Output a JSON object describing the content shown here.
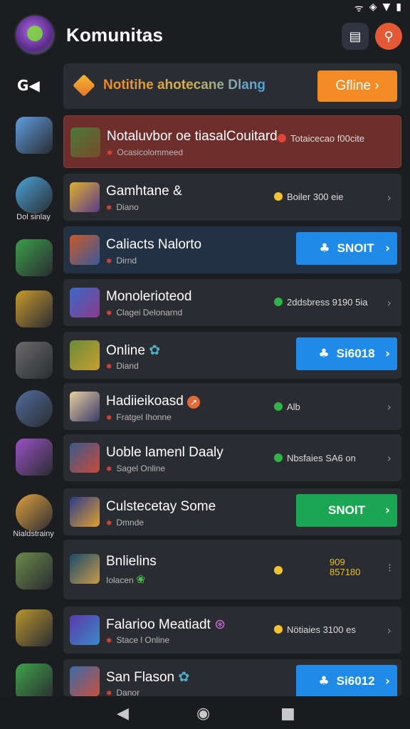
{
  "status_icons": [
    "signal-icon",
    "vibrate-icon",
    "wifi-icon",
    "battery-icon"
  ],
  "header": {
    "title": "Komunitas"
  },
  "sidebar": {
    "back_label": "G◀",
    "items": [
      {
        "label": "",
        "color": "#5e9de0"
      },
      {
        "label": "Dol sinlay",
        "color": "#4aa3d8"
      },
      {
        "label": "",
        "color": "#3d9e4a"
      },
      {
        "label": "",
        "color": "#c99a2e"
      },
      {
        "label": "",
        "color": "#6b6b6b"
      },
      {
        "label": "",
        "color": "#506c9c"
      },
      {
        "label": "",
        "color": "#9a52c4"
      },
      {
        "label": "Nialdstrainy",
        "color": "#e0a040"
      },
      {
        "label": "",
        "color": "#6a8a4a"
      },
      {
        "label": "",
        "color": "#b8952e"
      },
      {
        "label": "",
        "color": "#3ea34a"
      }
    ]
  },
  "banner": {
    "text": "Notitihe ahotecane Dlang",
    "button": "Gfline ›"
  },
  "rows": [
    {
      "title": "Notaluvbor oe tiasalCouitard",
      "title_icon": "🔴",
      "sub": "Ocasicolommeed",
      "stat": "Totaicecao f00cite",
      "action": ""
    },
    {
      "title": "Gamhtane &",
      "title_icon": "",
      "sub": "Diano",
      "stat": "Boiler  300 eie",
      "action": ""
    },
    {
      "title": "Caliacts Nalorto",
      "title_icon": "",
      "sub": "Dirnd",
      "stat": "",
      "action": "SNOIT"
    },
    {
      "title": "Monolerioteod",
      "title_icon": "",
      "sub": "Clagei Delonarnd",
      "stat": "2ddsbress 9190 5ia",
      "action": ""
    },
    {
      "title": "Online",
      "title_icon": "✿",
      "sub": "Diand",
      "stat": "",
      "action": "Si6018"
    },
    {
      "title": "Hadiieikoasd",
      "title_icon": "↗",
      "sub": "Fratgel Ihonne",
      "stat": "Alb",
      "action": ""
    },
    {
      "title": "Uoble lamenl Daaly",
      "title_icon": "",
      "sub": "Sagel Online",
      "stat": "Nbsfaies SA6 on",
      "action": ""
    },
    {
      "title": "Culstecetay Some",
      "title_icon": "",
      "sub": "Dmnde",
      "stat": "",
      "action": "SNOIT"
    },
    {
      "title": "Bnlielins",
      "title_icon": "",
      "sub": "Iolacen",
      "stat": "",
      "action": "",
      "values": [
        "909",
        "857180"
      ]
    },
    {
      "title": "Falarioo Meatiadt",
      "title_icon": "⊛",
      "sub": "Stace l Online",
      "stat": "Nötiaies 3100 es",
      "action": ""
    },
    {
      "title": "San Flason",
      "title_icon": "✿",
      "sub": "Danor",
      "stat": "",
      "action": "Si6012"
    }
  ],
  "colors": {
    "accent_orange": "#f58b24",
    "accent_blue": "#1f8ae8",
    "accent_green": "#1aa652",
    "accent_red": "#e45a36"
  }
}
